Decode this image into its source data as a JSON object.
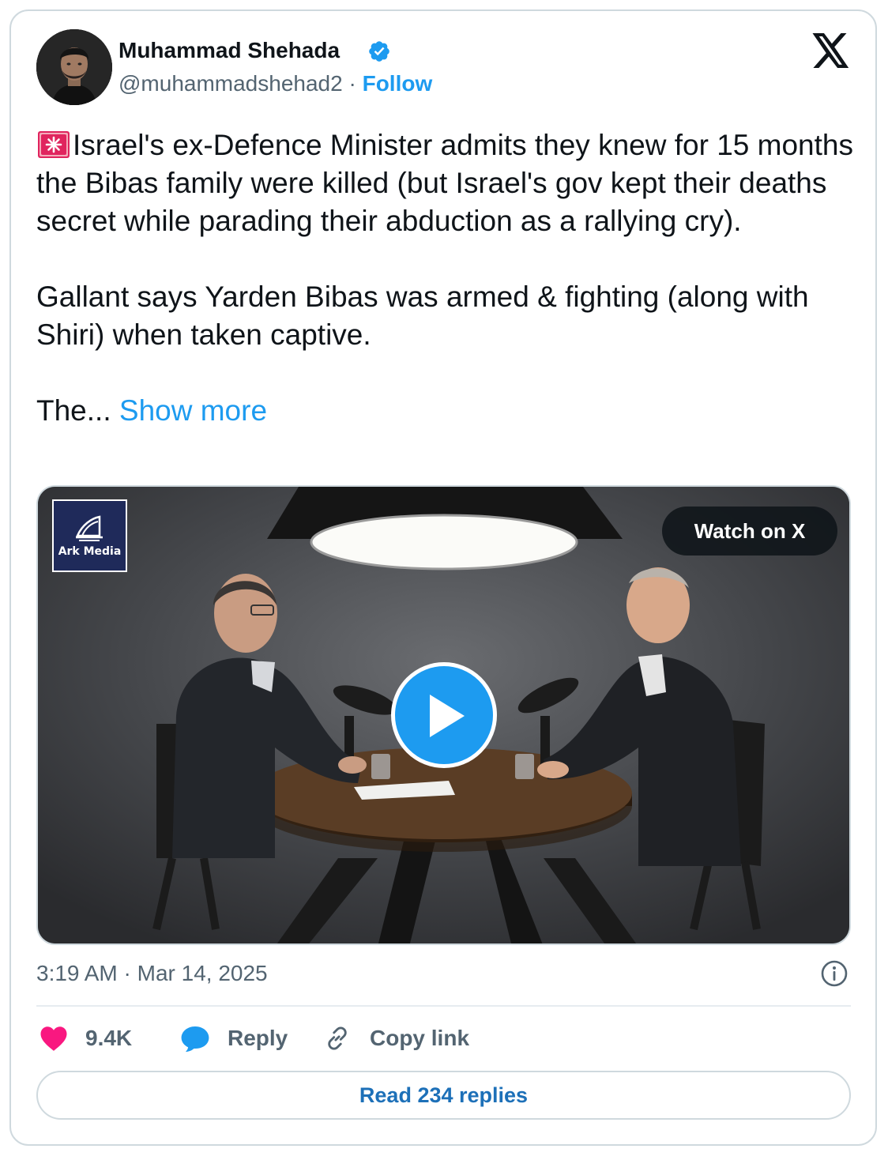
{
  "author": {
    "name": "Muhammad Shehada",
    "handle": "@muhammadshehad2",
    "separator": "·",
    "follow_label": "Follow",
    "verified_icon": "verified-badge-icon"
  },
  "tweet": {
    "paragraphs": [
      "Israel's ex-Defence Minister admits they knew for 15 months the Bibas family were killed (but Israel's gov kept their deaths secret while parading their abduction as a rallying cry).",
      "Gallant says Yarden Bibas was armed & fighting (along with Shiri) when taken captive.",
      "The..."
    ],
    "show_more_label": "Show more"
  },
  "media": {
    "watermark_text": "Ark Media",
    "watch_label": "Watch on X",
    "play_icon": "play-icon"
  },
  "meta": {
    "time": "3:19 AM",
    "separator": "·",
    "date": "Mar 14, 2025"
  },
  "actions": {
    "likes_count": "9.4K",
    "reply_label": "Reply",
    "copy_link_label": "Copy link"
  },
  "read_replies_label": "Read 234 replies",
  "colors": {
    "accent": "#1d9bf0",
    "like": "#f91880",
    "text_primary": "#0f1419",
    "text_secondary": "#536471",
    "border": "#cfd9de"
  }
}
